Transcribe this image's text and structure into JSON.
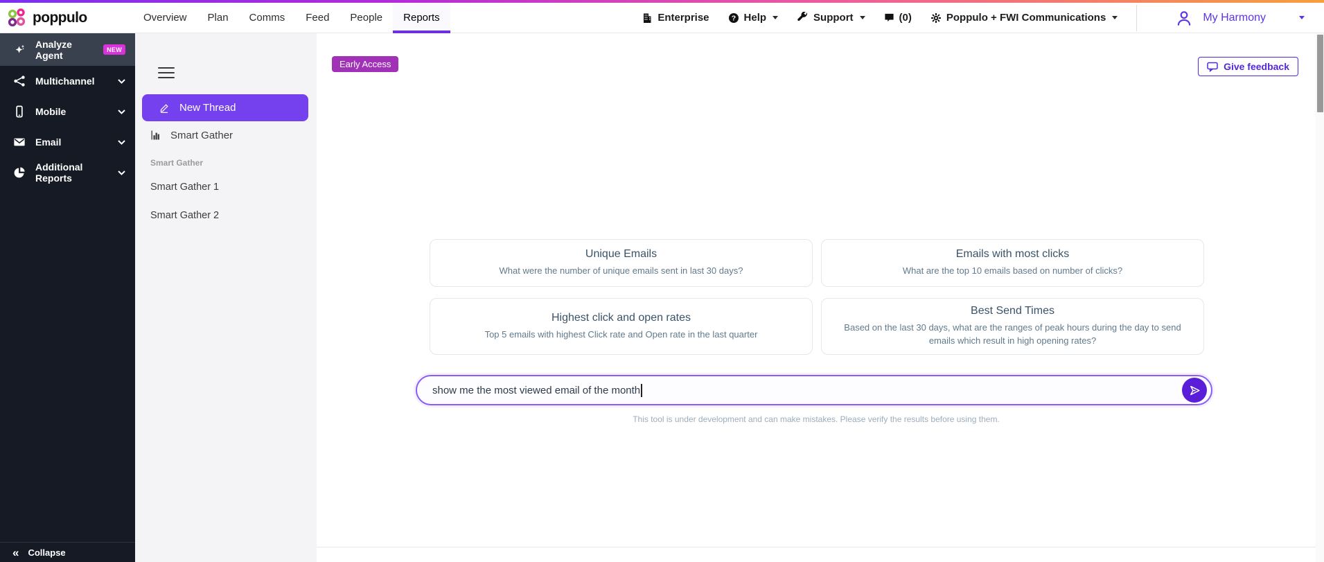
{
  "topbar": {
    "logo_text": "poppulo",
    "nav": [
      "Overview",
      "Plan",
      "Comms",
      "Feed",
      "People",
      "Reports"
    ],
    "right": {
      "enterprise_label": "Enterprise",
      "help_label": "Help",
      "support_label": "Support",
      "notifications_count": "(0)",
      "org_label": "Poppulo + FWI Communications",
      "user_label": "My Harmony"
    }
  },
  "sidebar": {
    "items": [
      {
        "label": "Analyze Agent",
        "badge": "NEW",
        "icon": "sparkles-icon"
      },
      {
        "label": "Multichannel",
        "icon": "multichannel-icon"
      },
      {
        "label": "Mobile",
        "icon": "mobile-icon"
      },
      {
        "label": "Email",
        "icon": "email-icon"
      },
      {
        "label": "Additional Reports",
        "icon": "pie-chart-icon"
      }
    ],
    "collapse_icon": "«",
    "collapse_label": "Collapse"
  },
  "panel": {
    "new_thread_label": "New Thread",
    "smart_gather_label": "Smart Gather",
    "section_title": "Smart Gather",
    "threads": [
      "Smart Gather 1",
      "Smart Gather 2"
    ]
  },
  "main": {
    "early_access_label": "Early Access",
    "feedback_label": "Give feedback",
    "cards": [
      {
        "title": "Unique Emails",
        "desc": "What were the number of unique emails sent in last 30 days?"
      },
      {
        "title": "Emails with most clicks",
        "desc": "What are the top 10 emails based on number of clicks?"
      },
      {
        "title": "Highest click and open rates",
        "desc": "Top 5 emails with highest Click rate and Open rate in the last quarter"
      },
      {
        "title": "Best Send Times",
        "desc": "Based on the last 30 days, what are the ranges of peak hours during the day to send emails which result in high opening rates?"
      }
    ],
    "input_value": "show me the most viewed email of the month",
    "disclaimer": "This tool is under development and can make mistakes. Please verify the results before using them."
  },
  "colors": {
    "accent_purple": "#6d2fe0",
    "new_thread_purple": "#7540ee",
    "badge_magenta": "#d733d9",
    "early_access_purple": "#a132b8",
    "send_button_purple": "#5a1ed8",
    "sidebar_dark": "#151a24",
    "gradient": [
      "#7b2ff0",
      "#b42bd9",
      "#ee5a9e",
      "#f6a03c"
    ]
  }
}
